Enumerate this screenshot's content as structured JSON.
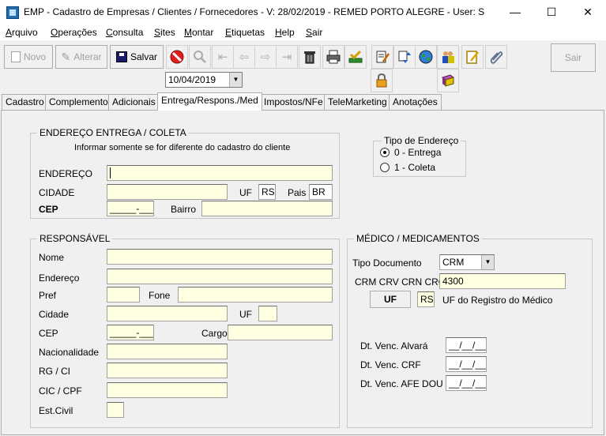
{
  "window": {
    "title": "EMP - Cadastro de Empresas / Clientes / Fornecedores - V: 28/02/2019 - REMED PORTO ALEGRE - User: S",
    "minimize": "—",
    "maximize": "☐",
    "close": "✕"
  },
  "menu": [
    {
      "pre": "",
      "ul": "A",
      "post": "rquivo"
    },
    {
      "pre": "",
      "ul": "O",
      "post": "perações"
    },
    {
      "pre": "",
      "ul": "C",
      "post": "onsulta"
    },
    {
      "pre": "",
      "ul": "S",
      "post": "ites"
    },
    {
      "pre": "",
      "ul": "M",
      "post": "ontar"
    },
    {
      "pre": "",
      "ul": "E",
      "post": "tiquetas"
    },
    {
      "pre": "",
      "ul": "H",
      "post": "elp"
    },
    {
      "pre": "",
      "ul": "S",
      "post": "air"
    }
  ],
  "toolbar": {
    "novo": "Novo",
    "alterar": "Alterar",
    "salvar": "Salvar",
    "sair": "Sair",
    "date": "10/04/2019"
  },
  "tabs": [
    "Cadastro",
    "Complemento",
    "Adicionais",
    "Entrega/Respons./Med",
    "Impostos/NFe",
    "TeleMarketing",
    "Anotações"
  ],
  "entrega": {
    "title": "ENDEREÇO ENTREGA / COLETA",
    "note": "Informar somente se for diferente do cadastro do cliente",
    "endereco_label": "ENDEREÇO",
    "cidade_label": "CIDADE",
    "uf_label": "UF",
    "uf_value": "RS",
    "pais_label": "Pais",
    "pais_value": "BR",
    "cep_label": "CEP",
    "cep_mask": "_____-___",
    "bairro_label": "Bairro"
  },
  "tipo_endereco": {
    "title": "Tipo de Endereço",
    "options": [
      "0 - Entrega",
      "1 - Coleta"
    ],
    "selected": 0
  },
  "responsavel": {
    "title": "RESPONSÁVEL",
    "nome": "Nome",
    "endereco": "Endereço",
    "pref": "Pref",
    "fone": "Fone",
    "cidade": "Cidade",
    "uf": "UF",
    "cep": "CEP",
    "cep_mask": "_____-___",
    "cargo": "Cargo",
    "nacionalidade": "Nacionalidade",
    "rg": "RG / CI",
    "cic": "CIC / CPF",
    "est_civil": "Est.Civil"
  },
  "medico": {
    "title": "MÉDICO / MEDICAMENTOS",
    "tipo_doc_label": "Tipo Documento",
    "tipo_doc_value": "CRM",
    "crm_label": "CRM CRV CRN CRO",
    "crm_value": "4300",
    "uf_button": "UF",
    "uf_value": "RS",
    "uf_desc": "UF do Registro do Médico",
    "alvara_label": "Dt. Venc. Alvará",
    "crf_label": "Dt. Venc. CRF",
    "afe_label": "Dt. Venc. AFE DOU",
    "date_mask": "__/__/__"
  }
}
